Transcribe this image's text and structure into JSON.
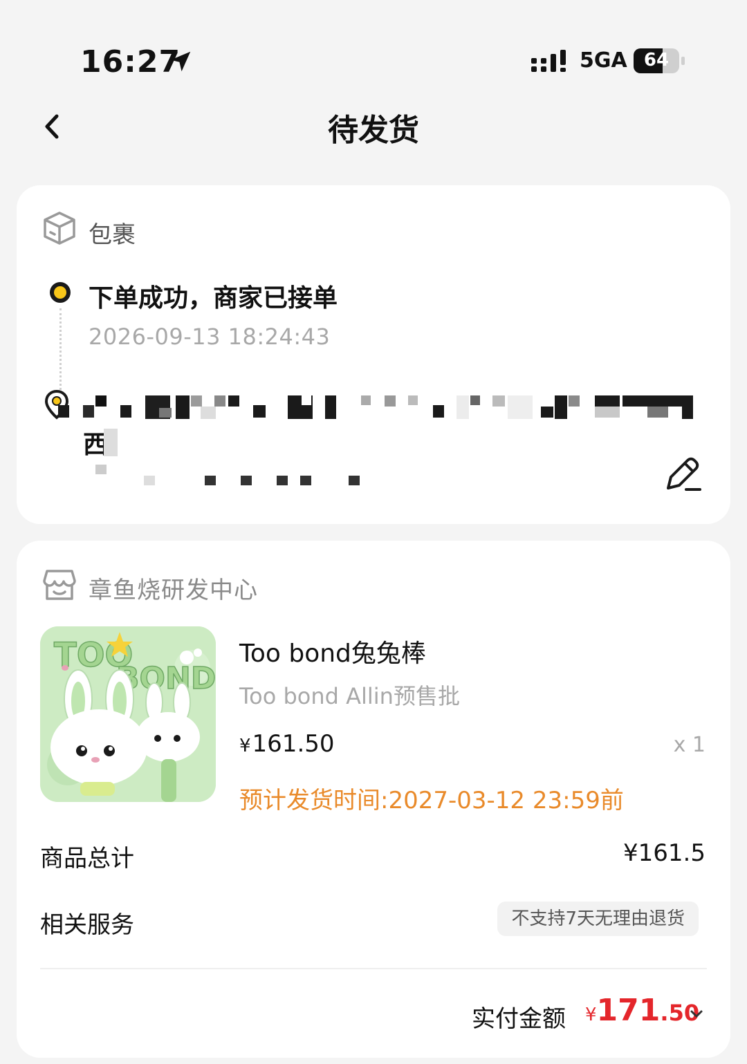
{
  "status_bar": {
    "time": "16:27",
    "network": "5GA",
    "battery_level": "64"
  },
  "header": {
    "title": "待发货"
  },
  "package": {
    "label": "包裹",
    "status": "下单成功，商家已接单",
    "time": "2026-09-13 18:24:43",
    "address_visible_char": "西"
  },
  "order": {
    "shop_name": "章鱼烧研发中心",
    "product": {
      "name": "Too bond兔兔棒",
      "spec": "Too bond Allin预售批",
      "price_symbol": "¥",
      "price": "161.50",
      "quantity": "x 1",
      "ship_time": "预计发货时间:2027-03-12 23:59前"
    },
    "subtotal_label": "商品总计",
    "subtotal_value": "¥161.5",
    "service_label": "相关服务",
    "service_tag": "不支持7天无理由退货",
    "paid_label": "实付金额",
    "paid_symbol": "¥",
    "paid_int": "171",
    "paid_dec": ".50"
  },
  "colors": {
    "accent_yellow": "#f8c619",
    "price_red": "#e4262b",
    "ship_orange": "#e98a2a",
    "card_bg": "#ffffff",
    "page_bg": "#f4f4f4"
  }
}
